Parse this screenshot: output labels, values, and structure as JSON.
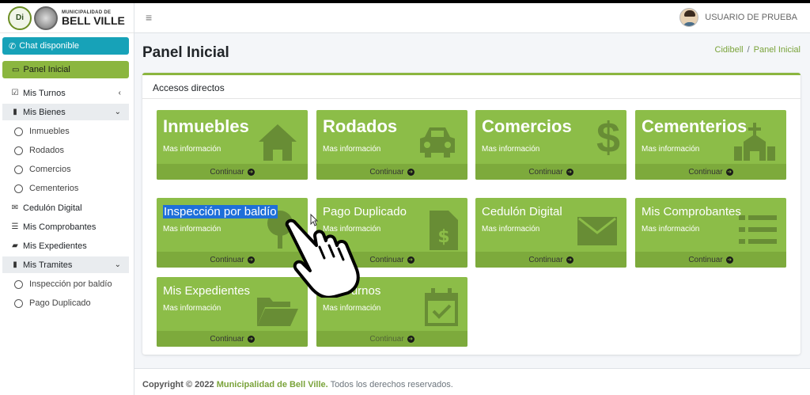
{
  "brand": {
    "logo_text": "Di",
    "small": "MUNICIPALIDAD DE",
    "big": "BELL VILLE"
  },
  "sidebar": {
    "chat": "Chat disponible",
    "panel": "Panel Inicial",
    "items": [
      {
        "label": "Mis Turnos",
        "icon": "calendar-check-icon"
      },
      {
        "label": "Mis Bienes",
        "icon": "trash-icon"
      },
      {
        "label": "Inmuebles"
      },
      {
        "label": "Rodados"
      },
      {
        "label": "Comercios"
      },
      {
        "label": "Cementerios"
      },
      {
        "label": "Cedulón Digital",
        "icon": "envelope-icon"
      },
      {
        "label": "Mis Comprobantes",
        "icon": "list-icon"
      },
      {
        "label": "Mis Expedientes",
        "icon": "folder-open-icon"
      },
      {
        "label": "Mis Tramites",
        "icon": "trash-icon"
      },
      {
        "label": "Inspección por baldío"
      },
      {
        "label": "Pago Duplicado"
      }
    ]
  },
  "header": {
    "menu_icon": "≡",
    "user": "USUARIO DE PRUEBA"
  },
  "page": {
    "title": "Panel Inicial",
    "breadcrumb": [
      "Cidibell",
      "/",
      "Panel Inicial"
    ],
    "card_title": "Accesos directos"
  },
  "tiles": [
    {
      "title": "Inmuebles",
      "sub": "Mas información",
      "footer": "Continuar",
      "icon": "house-icon"
    },
    {
      "title": "Rodados",
      "sub": "Mas información",
      "footer": "Continuar",
      "icon": "car-icon"
    },
    {
      "title": "Comercios",
      "sub": "Mas información",
      "footer": "Continuar",
      "icon": "dollar-icon"
    },
    {
      "title": "Cementerios",
      "sub": "Mas información",
      "footer": "Continuar",
      "icon": "church-icon"
    },
    {
      "title": "Inspección por baldío",
      "sub": "Mas información",
      "footer": "Continuar",
      "icon": "tree-icon"
    },
    {
      "title": "Pago Duplicado",
      "sub": "Mas información",
      "footer": "Continuar",
      "icon": "invoice-dollar-icon"
    },
    {
      "title": "Cedulón Digital",
      "sub": "Mas información",
      "footer": "Continuar",
      "icon": "envelope-icon"
    },
    {
      "title": "Mis Comprobantes",
      "sub": "Mas información",
      "footer": "Continuar",
      "icon": "list-icon"
    },
    {
      "title": "Mis Expedientes",
      "sub": "Mas información",
      "footer": "Continuar",
      "icon": "folder-open-icon"
    },
    {
      "title": "Mis Turnos",
      "sub": "Mas información",
      "footer": "Continuar",
      "icon": "calendar-check-icon"
    }
  ],
  "footer": {
    "prefix": "Copyright © 2022",
    "brand": "Municipalidad de Bell Ville.",
    "suffix": "Todos los derechos reservados."
  },
  "colors": {
    "accent": "#8bc34a",
    "chat": "#17a2b8",
    "highlight": "#1e6fd9"
  }
}
